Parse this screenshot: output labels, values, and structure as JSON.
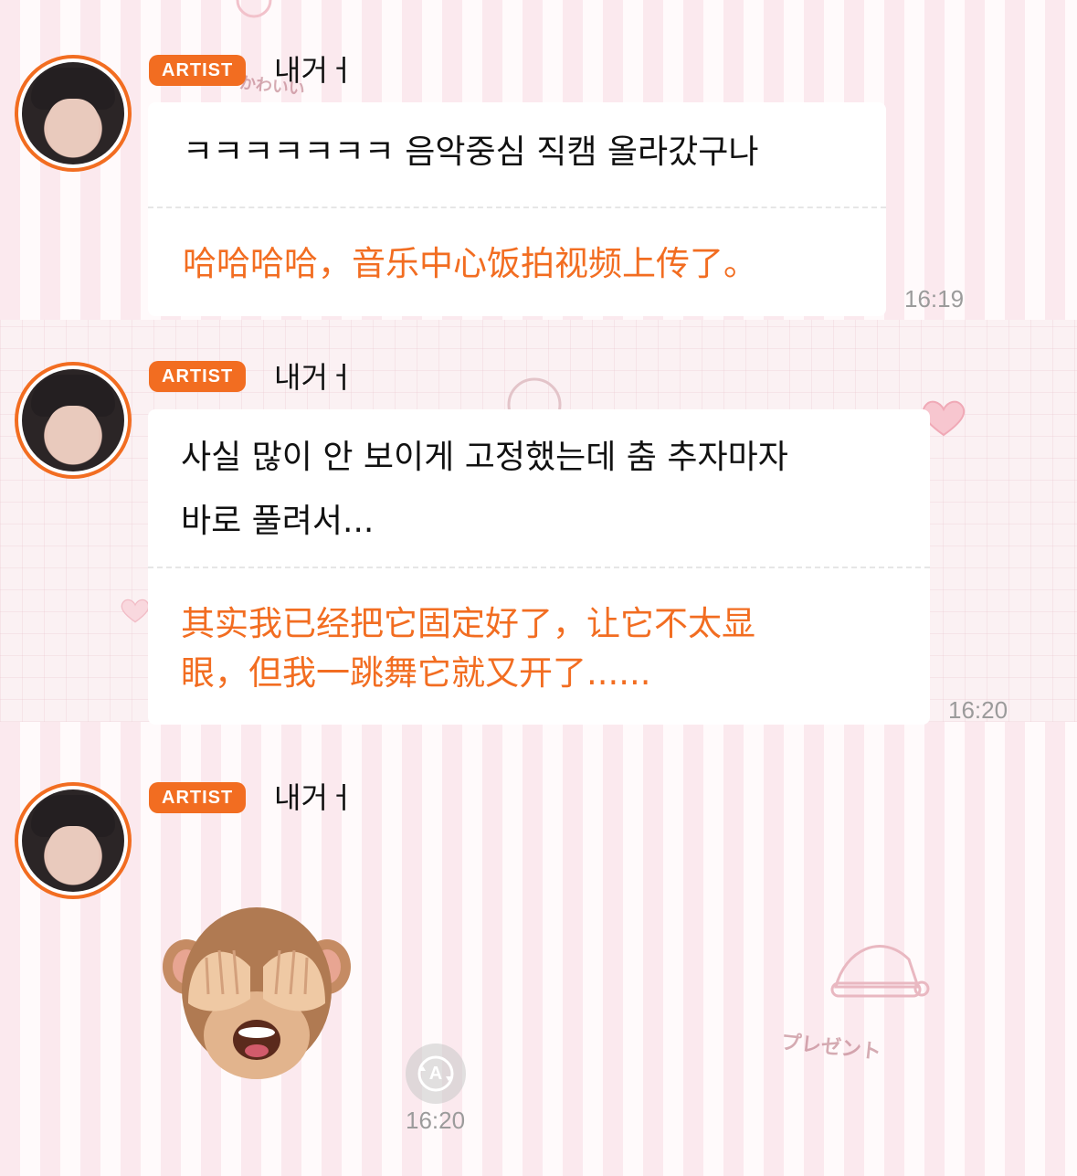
{
  "messages": [
    {
      "badge": "ARTIST",
      "name": "내거ㅓ",
      "text": "ㅋㅋㅋㅋㅋㅋㅋ 음악중심 직캠 올라갔구나",
      "translation": "哈哈哈哈，音乐中心饭拍视频上传了。",
      "time": "16:19"
    },
    {
      "badge": "ARTIST",
      "name": "내거ㅓ",
      "text_lines": [
        "사실 많이 안 보이게 고정했는데 춤 추자마자",
        "바로 풀려서..."
      ],
      "translation_lines": [
        "其实我已经把它固定好了，让它不太显",
        "眼，但我一跳舞它就又开了......"
      ],
      "time": "16:20"
    },
    {
      "badge": "ARTIST",
      "name": "내거ㅓ",
      "emoji": "🙈",
      "emoji_name": "see-no-evil-monkey",
      "translate_icon": "A",
      "time": "16:20"
    }
  ],
  "background": {
    "decor_text": "プレゼント",
    "decor_text_top": "かわいい"
  },
  "colors": {
    "accent": "#f26d21",
    "timestamp": "#9b9b9b",
    "bubble": "#ffffff"
  }
}
